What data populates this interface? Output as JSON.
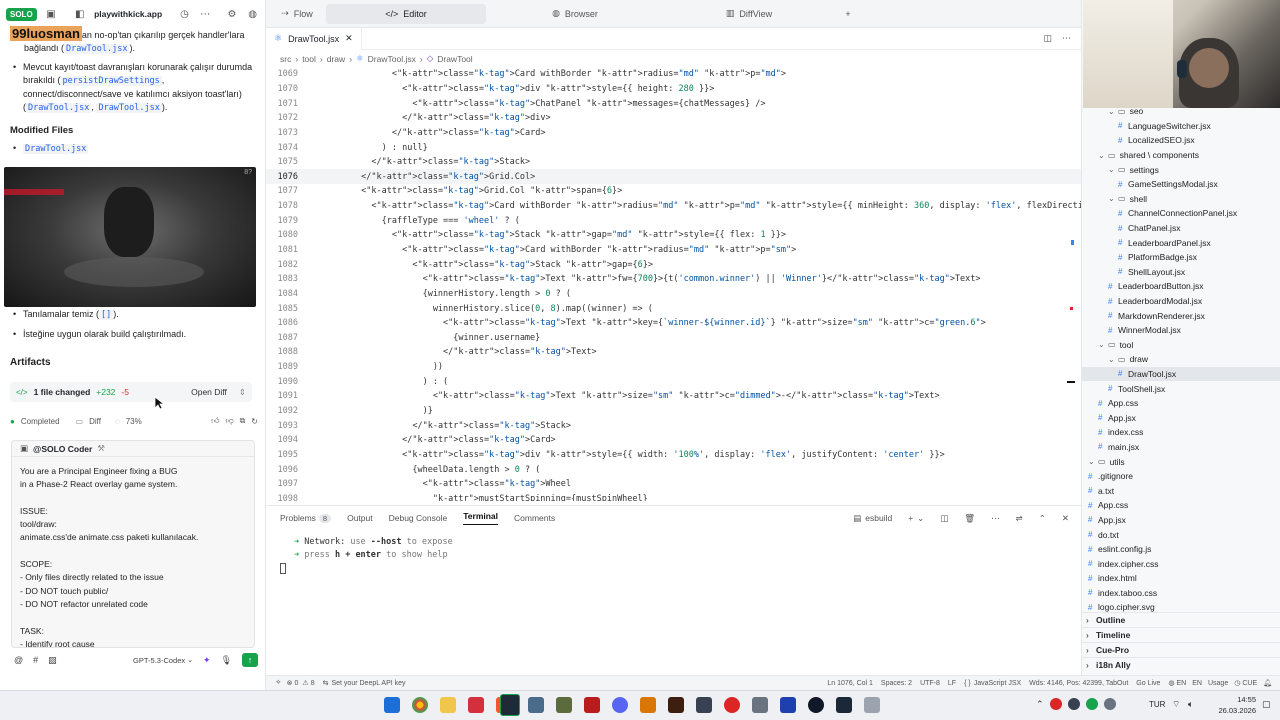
{
  "left": {
    "app_badge": "SOLO",
    "app_name": "playwithkick.app",
    "overlay_username": "99luosman",
    "msg_line1_rest": "an no-op'tan çıkarılıp gerçek handler'lara",
    "msg_line2_prefix": "bağlandı (",
    "msg_line2_code": "DrawTool.jsx",
    "msg_line2_suffix": ").",
    "bullet1_line1": "Mevcut kayıt/toast davranışları korunarak çalışır durumda",
    "bullet1_line2_prefix": "bırakıldı (",
    "bullet1_line2_code": "persistDrawSettings",
    "bullet1_line2_suffix": ",",
    "bullet1_line3": "connect/disconnect/save ve katılımcı aksiyon toast'ları)",
    "bullet1_line4_prefix": "(",
    "bullet1_line4_code1": "DrawTool.jsx",
    "bullet1_line4_sep": ",",
    "bullet1_line4_code2": "DrawTool.jsx",
    "bullet1_line4_suffix": ").",
    "modified_files_title": "Modified Files",
    "modified_file": "DrawTool.jsx",
    "video_timestamp": "8?",
    "bullet2_prefix": "Tanılamalar temiz (",
    "bullet2_code": "[]",
    "bullet2_suffix": ").",
    "bullet3": "İsteğine uygun olarak build çalıştırılmadı.",
    "artifacts_title": "Artifacts",
    "files_changed": "1 file changed",
    "additions": "+232",
    "deletions": "-5",
    "open_diff": "Open Diff",
    "completed": "Completed",
    "diff": "Diff",
    "progress": "73%",
    "agent_name": "@SOLO Coder",
    "prompt_lines": [
      "You are a Principal Engineer fixing a BUG",
      "in a Phase-2 React overlay game system.",
      "",
      "ISSUE:",
      "tool/draw:",
      "animate.css'de animate.css paketi kullanılacak.",
      "",
      "SCOPE:",
      "- Only files directly related to the issue",
      "- DO NOT touch public/",
      "- DO NOT refactor unrelated code",
      "",
      "TASK:",
      "- Identify root cause"
    ],
    "model": "GPT-5.3-Codex"
  },
  "top_tabs": [
    {
      "label": "Flow",
      "icon": "flow-icon"
    },
    {
      "label": "Editor",
      "icon": "code-icon"
    },
    {
      "label": "Browser",
      "icon": "globe-icon"
    },
    {
      "label": "DiffView",
      "icon": "diff-icon"
    }
  ],
  "file_tab": "DrawTool.jsx",
  "breadcrumb": [
    "src",
    "tool",
    "draw",
    "DrawTool.jsx",
    "DrawTool"
  ],
  "code_lines": [
    {
      "n": "1069",
      "t": "                <Card withBorder radius=\"md\" p=\"md\">"
    },
    {
      "n": "1070",
      "t": "                  <div style={{ height: 280 }}>"
    },
    {
      "n": "1071",
      "t": "                    <ChatPanel messages={chatMessages} />"
    },
    {
      "n": "1072",
      "t": "                  </div>"
    },
    {
      "n": "1073",
      "t": "                </Card>"
    },
    {
      "n": "1074",
      "t": "              ) : null}"
    },
    {
      "n": "1075",
      "t": "            </Stack>"
    },
    {
      "n": "1076",
      "t": "          </Grid.Col>"
    },
    {
      "n": "1077",
      "t": "          <Grid.Col span={6}>"
    },
    {
      "n": "1078",
      "t": "            <Card withBorder radius=\"md\" p=\"md\" style={{ minHeight: 360, display: 'flex', flexDirection: 'column' }}>"
    },
    {
      "n": "1079",
      "t": "              {raffleType === 'wheel' ? ("
    },
    {
      "n": "1080",
      "t": "                <Stack gap=\"md\" style={{ flex: 1 }}>"
    },
    {
      "n": "1081",
      "t": "                  <Card withBorder radius=\"md\" p=\"sm\">"
    },
    {
      "n": "1082",
      "t": "                    <Stack gap={6}>"
    },
    {
      "n": "1083",
      "t": "                      <Text fw={700}>{t('common.winner') || 'Winner'}</Text>"
    },
    {
      "n": "1084",
      "t": "                      {winnerHistory.length > 0 ? ("
    },
    {
      "n": "1085",
      "t": "                        winnerHistory.slice(0, 8).map((winner) => ("
    },
    {
      "n": "1086",
      "t": "                          <Text key={`winner-${winner.id}`} size=\"sm\" c=\"green.6\">"
    },
    {
      "n": "1087",
      "t": "                            {winner.username}"
    },
    {
      "n": "1088",
      "t": "                          </Text>"
    },
    {
      "n": "1089",
      "t": "                        ))"
    },
    {
      "n": "1090",
      "t": "                      ) : ("
    },
    {
      "n": "1091",
      "t": "                        <Text size=\"sm\" c=\"dimmed\">-</Text>"
    },
    {
      "n": "1092",
      "t": "                      )}"
    },
    {
      "n": "1093",
      "t": "                    </Stack>"
    },
    {
      "n": "1094",
      "t": "                  </Card>"
    },
    {
      "n": "1095",
      "t": "                  <div style={{ width: '100%', display: 'flex', justifyContent: 'center' }}>"
    },
    {
      "n": "1096",
      "t": "                    {wheelData.length > 0 ? ("
    },
    {
      "n": "1097",
      "t": "                      <Wheel"
    },
    {
      "n": "1098",
      "t": "                        mustStartSpinning={mustSpinWheel}"
    }
  ],
  "current_line": "1076",
  "panel_tabs": [
    "Problems",
    "Output",
    "Debug Console",
    "Terminal",
    "Comments"
  ],
  "problems_count": "8",
  "terminal_profile": "esbuild",
  "terminal_lines": [
    {
      "arrow": "➜",
      "label": "Network:",
      "rest_prefix": " use ",
      "bold": "--host",
      "rest_suffix": " to expose"
    },
    {
      "arrow": "➜",
      "label": "press",
      "rest_prefix": " ",
      "bold": "h + enter",
      "rest_suffix": " to show help"
    }
  ],
  "tree": [
    {
      "label": "seo",
      "depth": 2,
      "kind": "folder"
    },
    {
      "label": "LanguageSwitcher.jsx",
      "depth": 3,
      "kind": "file"
    },
    {
      "label": "LocalizedSEO.jsx",
      "depth": 3,
      "kind": "file"
    },
    {
      "label": "shared \\ components",
      "depth": 1,
      "kind": "folder"
    },
    {
      "label": "settings",
      "depth": 2,
      "kind": "folder"
    },
    {
      "label": "GameSettingsModal.jsx",
      "depth": 3,
      "kind": "file"
    },
    {
      "label": "shell",
      "depth": 2,
      "kind": "folder"
    },
    {
      "label": "ChannelConnectionPanel.jsx",
      "depth": 3,
      "kind": "file"
    },
    {
      "label": "ChatPanel.jsx",
      "depth": 3,
      "kind": "file"
    },
    {
      "label": "LeaderboardPanel.jsx",
      "depth": 3,
      "kind": "file"
    },
    {
      "label": "PlatformBadge.jsx",
      "depth": 3,
      "kind": "file"
    },
    {
      "label": "ShellLayout.jsx",
      "depth": 3,
      "kind": "file"
    },
    {
      "label": "LeaderboardButton.jsx",
      "depth": 2,
      "kind": "file"
    },
    {
      "label": "LeaderboardModal.jsx",
      "depth": 2,
      "kind": "file"
    },
    {
      "label": "MarkdownRenderer.jsx",
      "depth": 2,
      "kind": "file"
    },
    {
      "label": "WinnerModal.jsx",
      "depth": 2,
      "kind": "file"
    },
    {
      "label": "tool",
      "depth": 1,
      "kind": "folder"
    },
    {
      "label": "draw",
      "depth": 2,
      "kind": "folder"
    },
    {
      "label": "DrawTool.jsx",
      "depth": 3,
      "kind": "file",
      "selected": true
    },
    {
      "label": "ToolShell.jsx",
      "depth": 2,
      "kind": "file"
    },
    {
      "label": "App.css",
      "depth": 1,
      "kind": "file"
    },
    {
      "label": "App.jsx",
      "depth": 1,
      "kind": "file"
    },
    {
      "label": "index.css",
      "depth": 1,
      "kind": "file"
    },
    {
      "label": "main.jsx",
      "depth": 1,
      "kind": "file"
    },
    {
      "label": "utils",
      "depth": 0,
      "kind": "folder"
    },
    {
      "label": ".gitignore",
      "depth": 0,
      "kind": "file"
    },
    {
      "label": "a.txt",
      "depth": 0,
      "kind": "file"
    },
    {
      "label": "App.css",
      "depth": 0,
      "kind": "file"
    },
    {
      "label": "App.jsx",
      "depth": 0,
      "kind": "file"
    },
    {
      "label": "do.txt",
      "depth": 0,
      "kind": "file"
    },
    {
      "label": "eslint.config.js",
      "depth": 0,
      "kind": "file"
    },
    {
      "label": "index.cipher.css",
      "depth": 0,
      "kind": "file"
    },
    {
      "label": "index.html",
      "depth": 0,
      "kind": "file"
    },
    {
      "label": "index.taboo.css",
      "depth": 0,
      "kind": "file"
    },
    {
      "label": "logo.cipher.svg",
      "depth": 0,
      "kind": "file"
    }
  ],
  "sections": [
    "Outline",
    "Timeline",
    "Cue-Pro",
    "i18n Ally"
  ],
  "status": {
    "deepl": "Set your DeepL API key",
    "position": "Ln 1076, Col 1",
    "spaces": "Spaces: 2",
    "encoding": "UTF-8",
    "eol": "LF",
    "language": "JavaScript JSX",
    "stats": "Wds: 4146, Pos: 42399, TabOut",
    "golive": "Go Live",
    "lang_en1": "EN",
    "lang_en2": "EN",
    "usage": "Usage",
    "cue": "CUE",
    "errors": "0",
    "warnings": "8"
  },
  "taskbar": {
    "lang": "TUR",
    "time": "14:55",
    "date": "26.03.2026"
  },
  "colors": {
    "accent_green": "#16a34a",
    "link_blue": "#2563eb",
    "selected_row": "#e3e6ea"
  }
}
